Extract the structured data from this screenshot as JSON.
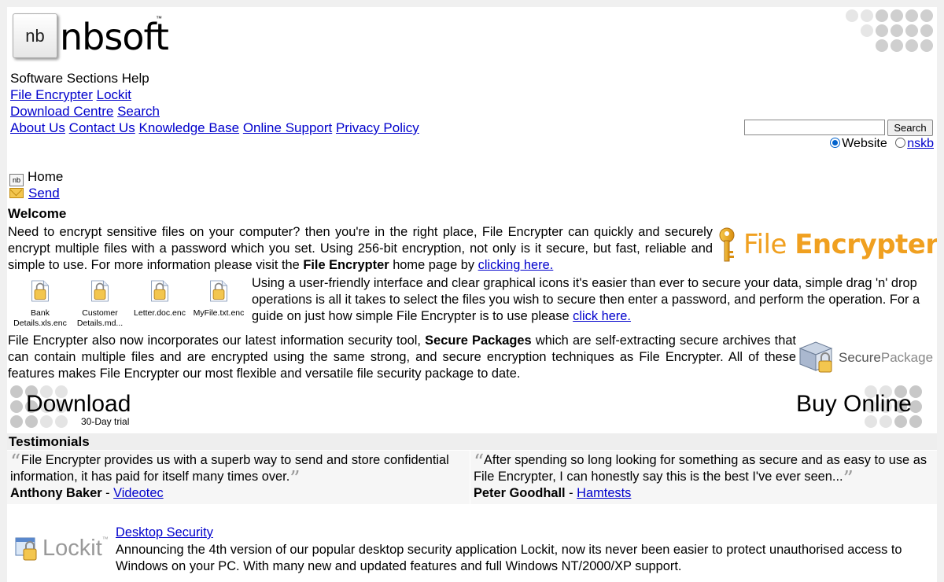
{
  "header": {
    "logo_icon_text": "nb",
    "logo_text": "nbsoft",
    "logo_tm": "™"
  },
  "nav": {
    "section_heading": "Software Sections Help",
    "row1": [
      "File Encrypter",
      "Lockit"
    ],
    "row2": [
      "Download Centre",
      "Search"
    ],
    "row3": [
      "About Us",
      "Contact Us",
      "Knowledge Base",
      "Online Support",
      "Privacy Policy"
    ]
  },
  "search": {
    "value": "",
    "button_label": "Search",
    "options": [
      {
        "label": "Website",
        "selected": true
      },
      {
        "label": "nskb",
        "selected": false
      }
    ]
  },
  "breadcrumb": {
    "home_icon": "nb",
    "home_label": "Home",
    "send_label": "Send"
  },
  "welcome": {
    "heading": "Welcome",
    "para1_pre": "Need to encrypt sensitive files on your computer? then you're in the right place, File Encrypter can quickly and securely encrypt multiple files with a password which you set. Using 256-bit encryption, not only is it secure, but fast, reliable and simple to use. For more information please visit the ",
    "para1_bold": "File Encrypter",
    "para1_mid": " home page by ",
    "para1_link": "clicking here.",
    "para2_pre": "Using a user-friendly interface and clear graphical icons it's easier than ever to secure your data, simple drag 'n' drop operations is all it takes to select the files you wish to secure then enter a password, and perform the operation. For a guide on just how simple File Encrypter is to use please ",
    "para2_link": "click here.",
    "para3_pre": "File Encrypter also now incorporates our latest information security tool, ",
    "para3_bold": "Secure Packages",
    "para3_post": " which are self-extracting secure archives that can contain multiple files and are encrypted using the same strong, and secure encryption techniques as File Encrypter. All of these features makes File Encrypter our most flexible and versatile file security package to date."
  },
  "fe_logo": {
    "light": "File ",
    "bold": "Encrypter",
    "color": "#f0a020"
  },
  "files": [
    {
      "line1": "Bank",
      "line2": "Details.xls.enc"
    },
    {
      "line1": "Customer",
      "line2": "Details.md..."
    },
    {
      "line1": "",
      "line2": "Letter.doc.enc"
    },
    {
      "line1": "",
      "line2": "MyFile.txt.enc"
    }
  ],
  "secure_package_logo": {
    "part1": "Secure",
    "part2": "Package"
  },
  "download": {
    "title": "Download",
    "subtitle": "30-Day trial"
  },
  "buy": {
    "title": "Buy Online"
  },
  "testimonials": {
    "heading": "Testimonials",
    "items": [
      {
        "quote": "File Encrypter provides us with a superb way to send and store confidential information, it has paid for itself many times over.",
        "author": "Anthony Baker",
        "separator": " - ",
        "company": "Videotec"
      },
      {
        "quote": "After spending so long looking for something as secure and as easy to use as File Encrypter, I can honestly say this is the best I've ever seen...",
        "author": "Peter Goodhall",
        "separator": " - ",
        "company": "Hamtests"
      }
    ]
  },
  "lockit": {
    "logo_text": "Lockit",
    "logo_tm": "™",
    "title": "Desktop Security",
    "description": "Announcing the 4th version of our popular desktop security application Lockit, now its never been easier to protect unauthorised access to Windows on your PC. With many new and updated features and full Windows NT/2000/XP support."
  }
}
